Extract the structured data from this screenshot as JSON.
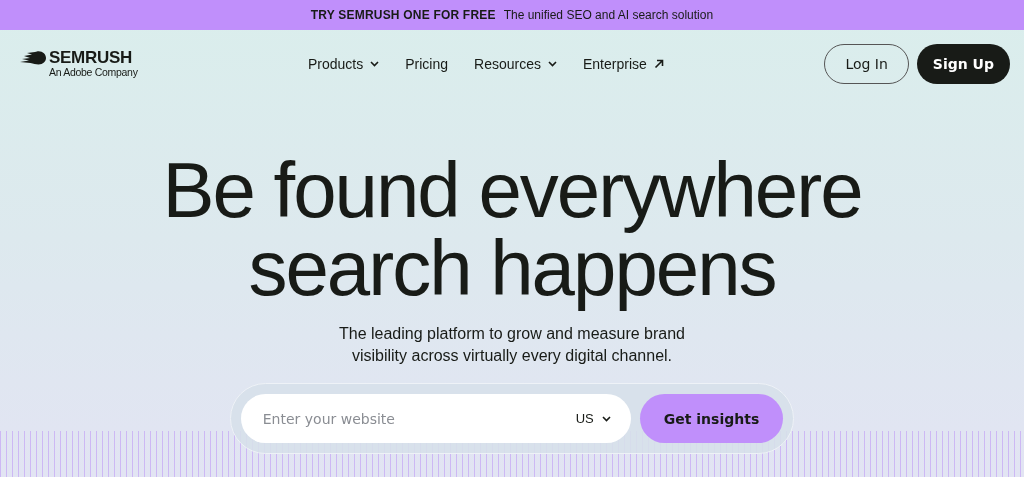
{
  "banner": {
    "title": "TRY SEMRUSH ONE FOR FREE",
    "text": "The unified SEO and AI search solution"
  },
  "logo": {
    "name": "SEMRUSH",
    "tagline": "An Adobe Company"
  },
  "nav": [
    {
      "label": "Products",
      "kind": "dropdown"
    },
    {
      "label": "Pricing",
      "kind": "link"
    },
    {
      "label": "Resources",
      "kind": "dropdown"
    },
    {
      "label": "Enterprise",
      "kind": "external"
    }
  ],
  "auth": {
    "login": "Log In",
    "signup": "Sign Up"
  },
  "hero": {
    "headline": [
      "Be found everywhere",
      "search happens"
    ],
    "subtitle": [
      "The leading platform to grow and measure brand",
      "visibility across virtually every digital channel."
    ]
  },
  "search": {
    "placeholder": "Enter your website",
    "country": "US",
    "button": "Get insights"
  }
}
